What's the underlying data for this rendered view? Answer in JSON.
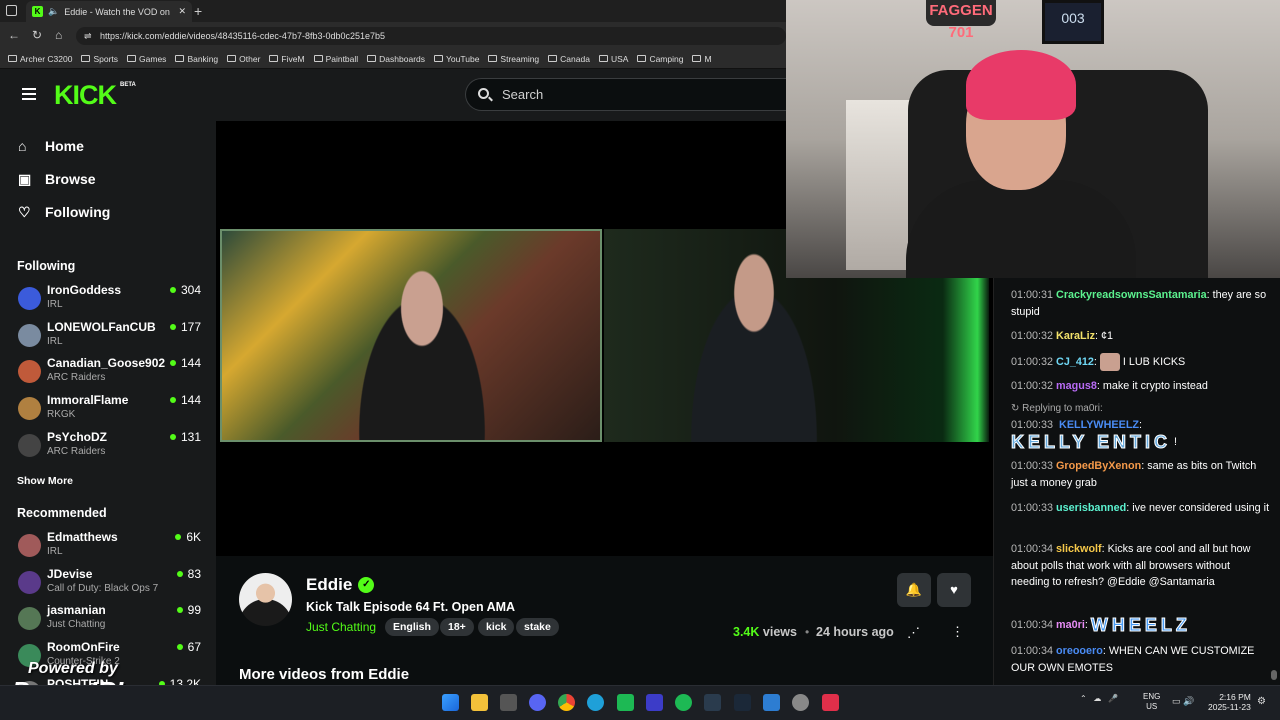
{
  "browser": {
    "tab_title": "Eddie - Watch the VOD on K",
    "url": "https://kick.com/eddie/videos/48435116-cdec-47b7-8fb3-0db0c251e7b5",
    "bookmarks": [
      "Archer C3200",
      "Sports",
      "Games",
      "Banking",
      "Other",
      "FiveM",
      "Paintball",
      "Dashboards",
      "YouTube",
      "Streaming",
      "Canada",
      "USA",
      "Camping",
      "M"
    ]
  },
  "header": {
    "logo": "KICK",
    "beta": "BETA",
    "search_placeholder": "Search"
  },
  "sidebar": {
    "nav": [
      "Home",
      "Browse",
      "Following"
    ],
    "following_title": "Following",
    "following": [
      {
        "name": "IronGoddess",
        "category": "IRL",
        "viewers": "304"
      },
      {
        "name": "LONEWOLFanCUB",
        "category": "IRL",
        "viewers": "177"
      },
      {
        "name": "Canadian_Goose902",
        "category": "ARC Raiders",
        "viewers": "144"
      },
      {
        "name": "ImmoralFlame",
        "category": "RKGK",
        "viewers": "144"
      },
      {
        "name": "PsYchoDZ",
        "category": "ARC Raiders",
        "viewers": "131"
      }
    ],
    "show_more": "Show More",
    "recommended_title": "Recommended",
    "recommended": [
      {
        "name": "Edmatthews",
        "category": "IRL",
        "viewers": "6K"
      },
      {
        "name": "JDevise",
        "category": "Call of Duty: Black Ops 7",
        "viewers": "83"
      },
      {
        "name": "jasmanian",
        "category": "Just Chatting",
        "viewers": "99"
      },
      {
        "name": "RoomOnFire",
        "category": "Counter-Strike 2",
        "viewers": "67"
      },
      {
        "name": "POSHTEIN",
        "category": "",
        "viewers": "13.2K"
      }
    ]
  },
  "video_info": {
    "channel": "Eddie",
    "title": "Kick Talk Episode 64 Ft. Open AMA",
    "category": "Just Chatting",
    "tags": [
      "English",
      "18+",
      "kick",
      "stake"
    ],
    "views": "3.4K",
    "views_label": "views",
    "ago": "24 hours ago",
    "more_videos": "More videos from Eddie"
  },
  "chat": [
    {
      "time": "01:00:31",
      "user": "CrackyreadsownsSantamaria",
      "color": "#5cf28f",
      "text": "they are so stupid"
    },
    {
      "time": "01:00:32",
      "user": "KaraLiz",
      "color": "#f3e26b",
      "text": "¢1"
    },
    {
      "time": "01:00:32",
      "user": "CJ_412",
      "color": "#6fd8f5",
      "text": "I LUB KICKS"
    },
    {
      "time": "01:00:32",
      "user": "magus8",
      "color": "#b86bf5",
      "text": "make it crypto instead"
    },
    {
      "time": "01:00:33",
      "user": "KELLYWHEELZ",
      "color": "#4a8cf5",
      "text": "!",
      "reply": "Replying to ma0ri:"
    },
    {
      "time": "01:00:33",
      "user": "GropedByXenon",
      "color": "#f59a4a",
      "text": "same as bits on Twitch just a money grab"
    },
    {
      "time": "01:00:33",
      "user": "userisbanned",
      "color": "#5cf2d0",
      "text": "ive never considered using it"
    },
    {
      "time": "01:00:34",
      "user": "slickwolf",
      "color": "#f5c84a",
      "text": "Kicks are cool and all but how about polls that work with all browsers without needing to refresh? @Eddie @Santamaria"
    },
    {
      "time": "01:00:34",
      "user": "ma0ri",
      "color": "#e68cf5",
      "text": ""
    },
    {
      "time": "01:00:34",
      "user": "oreooero",
      "color": "#4a8cf5",
      "text": "WHEN CAN WE CUSTOMIZE OUR OWN EMOTES"
    }
  ],
  "emotes": {
    "kellywheelz": "KELLY ENTIC",
    "ma0ri": "WHEELZ"
  },
  "webcam": {
    "sign": "FAGGEN 701",
    "frame_number": "003"
  },
  "overlay": {
    "powered_by": "Powered by",
    "brand": "PowerIRL"
  },
  "taskbar": {
    "lang_top": "ENG",
    "lang_bottom": "US",
    "time": "2:16 PM",
    "date": "2025-11-23"
  },
  "colors": {
    "accent": "#53fc18",
    "bg": "#0b0e0f",
    "sidebar": "#181a1b"
  }
}
